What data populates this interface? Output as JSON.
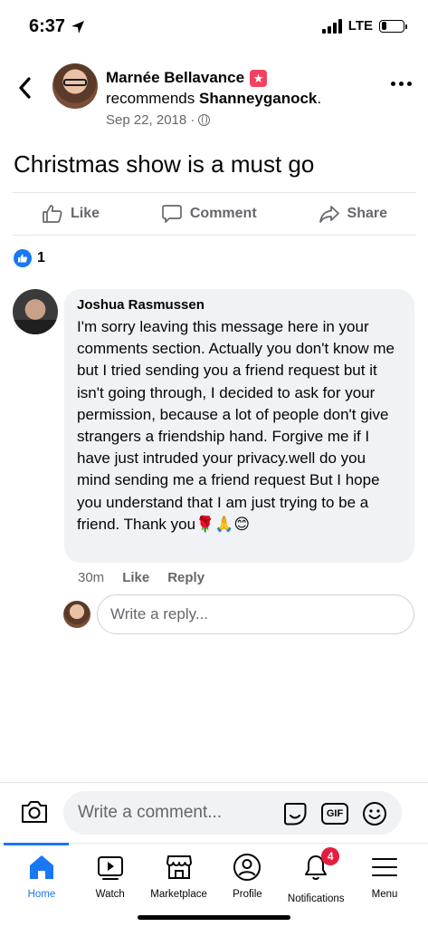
{
  "status_bar": {
    "time": "6:37",
    "network": "LTE",
    "battery_level_pct": 25
  },
  "post": {
    "author": "Marnée Bellavance",
    "recommend_prefix": "recommends",
    "recommended_page": "Shanneyganock",
    "recommend_suffix": ".",
    "date": "Sep 22, 2018 ·",
    "text": "Christmas show is a must go"
  },
  "actions": {
    "like": "Like",
    "comment": "Comment",
    "share": "Share"
  },
  "reactions": {
    "count": "1"
  },
  "comment": {
    "author": "Joshua Rasmussen",
    "text": "I'm sorry leaving this message here in your comments section. Actually you don't know me but I tried sending you a friend request but it isn't going through, I decided to ask for your permission, because a lot of people don't give strangers a friendship hand. Forgive me if I have just intruded your privacy.well do you mind sending me a friend request But I hope you understand that I am just trying to be a friend. Thank you🌹🙏😊",
    "time": "30m",
    "like_label": "Like",
    "reply_label": "Reply"
  },
  "reply_box": {
    "placeholder": "Write a reply..."
  },
  "composer": {
    "placeholder": "Write a comment...",
    "gif_label": "GIF"
  },
  "tabs": [
    {
      "label": "Home",
      "icon": "home-icon"
    },
    {
      "label": "Watch",
      "icon": "watch-icon"
    },
    {
      "label": "Marketplace",
      "icon": "marketplace-icon"
    },
    {
      "label": "Profile",
      "icon": "profile-icon"
    },
    {
      "label": "Notifications",
      "icon": "bell-icon",
      "badge": "4"
    },
    {
      "label": "Menu",
      "icon": "menu-icon"
    }
  ],
  "colors": {
    "accent": "#1877f2",
    "badge": "#e41e3f",
    "bubble": "#f0f2f5",
    "secondary_text": "#65676b"
  }
}
